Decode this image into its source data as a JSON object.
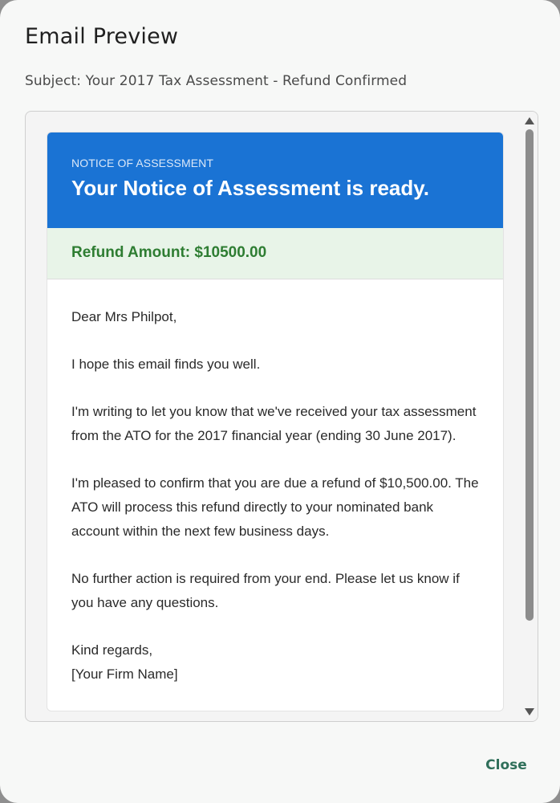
{
  "dialog": {
    "title": "Email Preview",
    "subject": "Subject: Your 2017 Tax Assessment - Refund Confirmed",
    "close_label": "Close"
  },
  "email": {
    "eyebrow": "NOTICE OF ASSESSMENT",
    "headline": "Your Notice of Assessment is ready.",
    "refund_line": "Refund Amount: $10500.00",
    "paragraphs": [
      "Dear Mrs Philpot,",
      "I hope this email finds you well.",
      "I'm writing to let you know that we've received your tax assessment from the ATO for the 2017 financial year (ending 30 June 2017).",
      "I'm pleased to confirm that you are due a refund of $10,500.00. The ATO will process this refund directly to your nominated bank account within the next few business days.",
      "No further action is required from your end. Please let us know if you have any questions."
    ],
    "signoff": "Kind regards,",
    "firm_name": "[Your Firm Name]"
  },
  "colors": {
    "header_bg": "#1a73d4",
    "refund_bg": "#e8f4e8",
    "refund_text": "#2e7d32",
    "close_text": "#2f6f5a"
  },
  "scrollbar": {
    "position_fraction": 0.0,
    "visible_fraction": 0.84
  }
}
